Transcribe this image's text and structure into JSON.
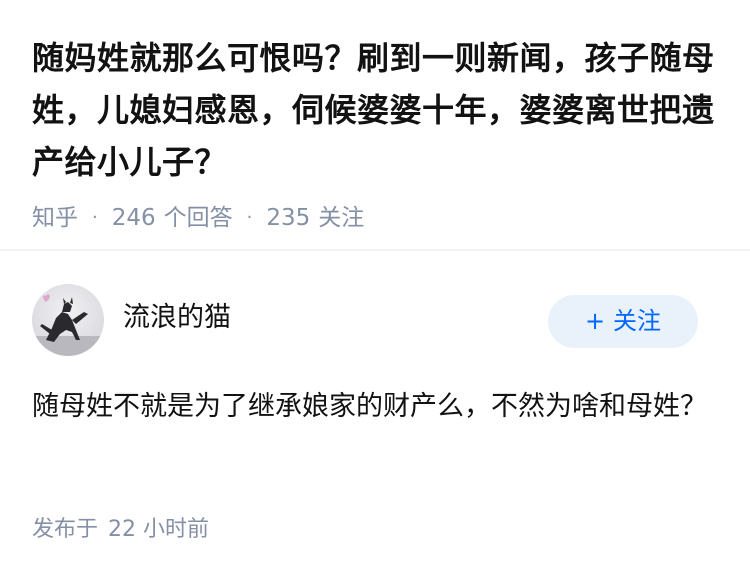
{
  "question": {
    "title": "随妈姓就那么可恨吗？刷到一则新闻，孩子随母姓，儿媳妇感恩，伺候婆婆十年，婆婆离世把遗产给小儿子？",
    "source": "知乎",
    "separator": "·",
    "answer_count": "246",
    "answer_suffix": "个回答",
    "follower_count": "235",
    "follower_suffix": "关注"
  },
  "answer": {
    "author": "流浪的猫",
    "avatar_icon": "cat-avatar-icon",
    "follow_label": "关注",
    "follow_plus": "+",
    "content": "随母姓不就是为了继承娘家的财产么，不然为啥和母姓？",
    "time_prefix": "发布于",
    "time_value": "22 小时前"
  },
  "colors": {
    "accent": "#0066ff",
    "follow_bg": "#e9f1fb",
    "meta_text": "#8590a6",
    "main_text": "#121212",
    "divider": "#f3f3f3"
  }
}
